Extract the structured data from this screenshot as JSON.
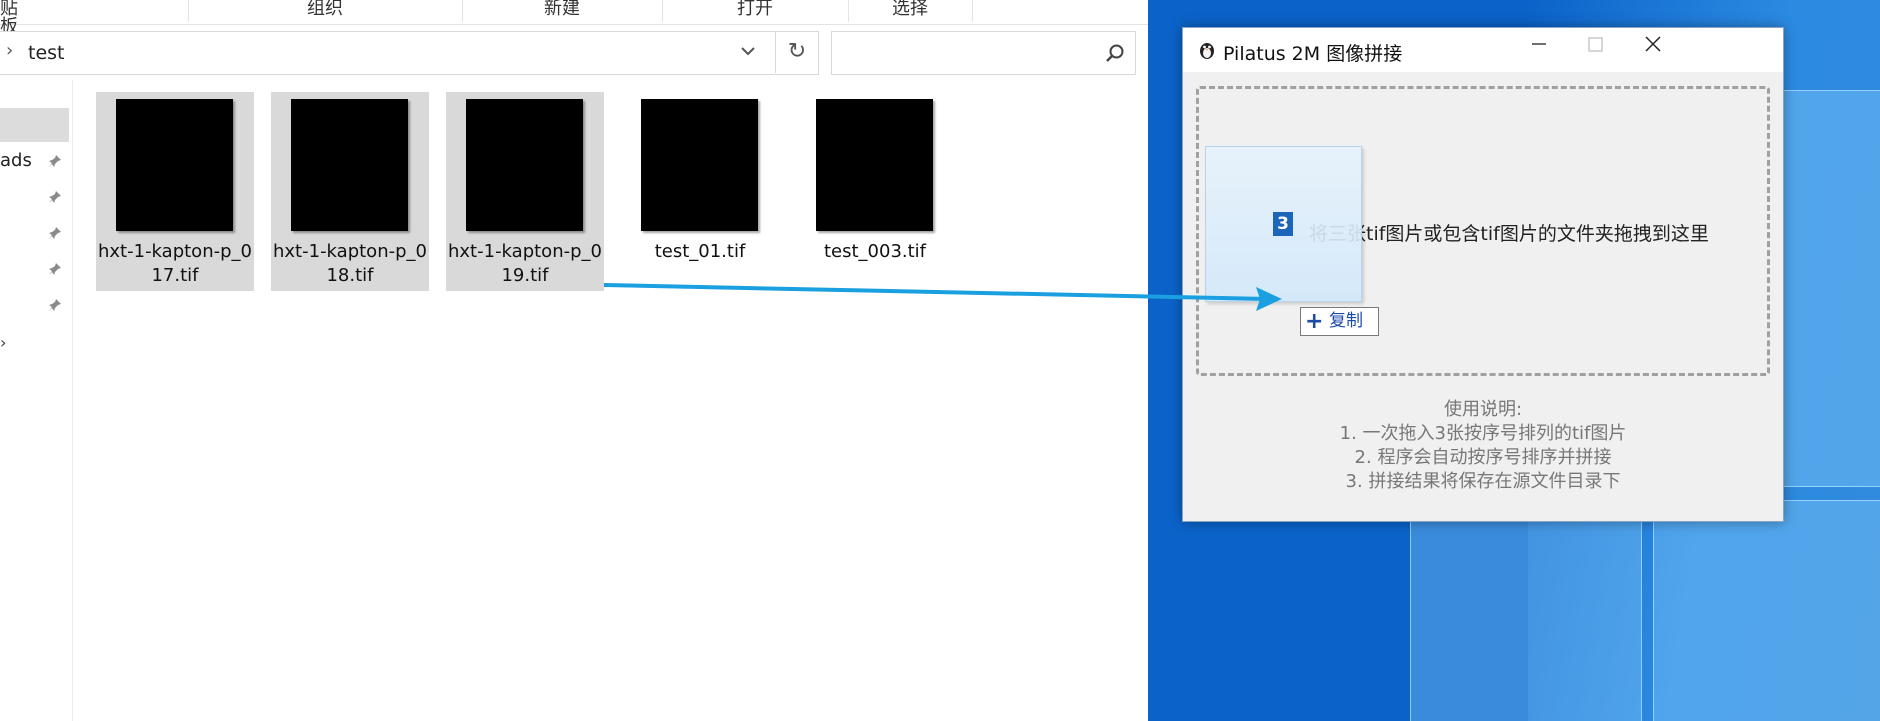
{
  "explorer": {
    "ribbon": {
      "items": [
        "贴板",
        "组织",
        "新建",
        "打开",
        "选择"
      ]
    },
    "address": {
      "path": "test"
    },
    "search": {
      "placeholder": ""
    },
    "nav": {
      "partial_item": "ads"
    },
    "files": [
      {
        "name": "hxt-1-kapton-p_017.tif",
        "selected": true
      },
      {
        "name": "hxt-1-kapton-p_018.tif",
        "selected": true
      },
      {
        "name": "hxt-1-kapton-p_019.tif",
        "selected": true
      },
      {
        "name": "test_01.tif",
        "selected": false
      },
      {
        "name": "test_003.tif",
        "selected": false
      }
    ]
  },
  "app": {
    "title": "Pilatus 2M 图像拼接",
    "drop_hint": "将三张tif图片或包含tif图片的文件夹拖拽到这里",
    "instructions": {
      "heading": "使用说明:",
      "lines": [
        "1. 一次拖入3张按序号排列的tif图片",
        "2. 程序会自动按序号排序并拼接",
        "3. 拼接结果将保存在源文件目录下"
      ]
    }
  },
  "drag": {
    "count": "3",
    "copy_label": "复制"
  },
  "colors": {
    "desktop": "#0b63c9",
    "arrow": "#1a9fe0",
    "selection": "#d9d9d9",
    "copy_text": "#1b4aa8"
  }
}
